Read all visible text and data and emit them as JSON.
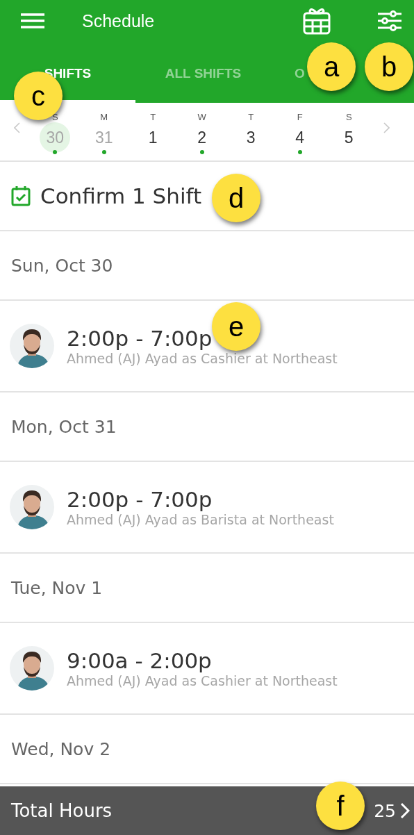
{
  "app_bar": {
    "title": "Schedule"
  },
  "tabs": [
    {
      "label": "SHIFTS",
      "selected": true
    },
    {
      "label": "ALL SHIFTS",
      "selected": false
    },
    {
      "label": "O",
      "selected": false
    }
  ],
  "week": [
    {
      "letter": "S",
      "number": "30",
      "past": true,
      "selected": true,
      "dot": true
    },
    {
      "letter": "M",
      "number": "31",
      "past": true,
      "selected": false,
      "dot": true
    },
    {
      "letter": "T",
      "number": "1",
      "past": false,
      "selected": false,
      "dot": false
    },
    {
      "letter": "W",
      "number": "2",
      "past": false,
      "selected": false,
      "dot": true
    },
    {
      "letter": "T",
      "number": "3",
      "past": false,
      "selected": false,
      "dot": false
    },
    {
      "letter": "F",
      "number": "4",
      "past": false,
      "selected": false,
      "dot": true
    },
    {
      "letter": "S",
      "number": "5",
      "past": false,
      "selected": false,
      "dot": false
    }
  ],
  "confirm": {
    "label": "Confirm 1 Shift"
  },
  "list": [
    {
      "kind": "date",
      "label": "Sun, Oct 30"
    },
    {
      "kind": "shift",
      "time": "2:00p - 7:00p",
      "detail": "Ahmed (AJ) Ayad as Cashier at Northeast"
    },
    {
      "kind": "date",
      "label": "Mon, Oct 31"
    },
    {
      "kind": "shift",
      "time": "2:00p - 7:00p",
      "detail": "Ahmed (AJ) Ayad as Barista at Northeast"
    },
    {
      "kind": "date",
      "label": "Tue, Nov 1"
    },
    {
      "kind": "shift",
      "time": "9:00a - 2:00p",
      "detail": "Ahmed (AJ) Ayad as Cashier at Northeast"
    },
    {
      "kind": "date",
      "label": "Wed, Nov 2"
    }
  ],
  "footer": {
    "label": "Total Hours",
    "value": "25"
  },
  "callouts": [
    {
      "letter": "a"
    },
    {
      "letter": "b"
    },
    {
      "letter": "c"
    },
    {
      "letter": "d"
    },
    {
      "letter": "e"
    },
    {
      "letter": "f"
    }
  ]
}
